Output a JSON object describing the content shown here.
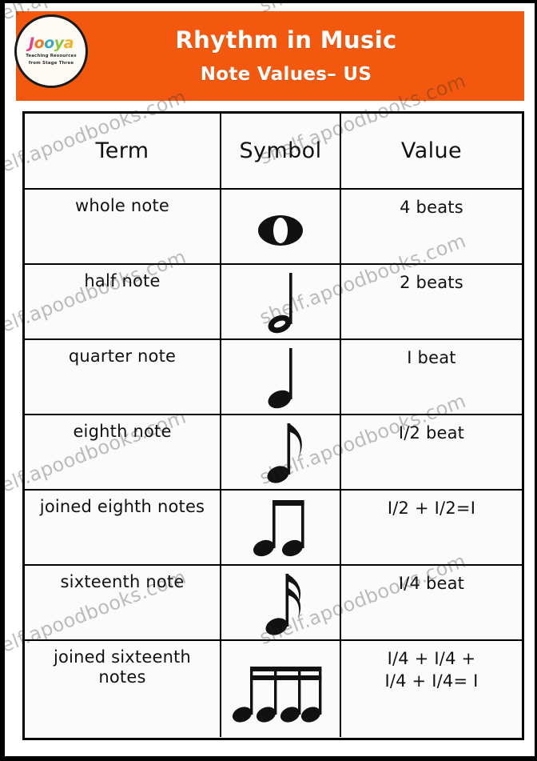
{
  "banner": {
    "title": "Rhythm in Music",
    "subtitle": "Note Values– US",
    "background_color": "#F2590F",
    "text_color": "#FFFFFF"
  },
  "logo": {
    "word": "Jooya",
    "letters": [
      "J",
      "o",
      "o",
      "y",
      "a"
    ],
    "tagline_line1": "Teaching Resources",
    "tagline_line2": "from Stage Three",
    "colors": [
      "#E8418A",
      "#F07C1E",
      "#3AA8C1",
      "#8CC63E",
      "#F0B323"
    ]
  },
  "table": {
    "headers": [
      "Term",
      "Symbol",
      "Value"
    ],
    "rows": [
      {
        "term": "whole note",
        "symbol": "whole-note",
        "value": "4 beats"
      },
      {
        "term": "half note",
        "symbol": "half-note",
        "value": "2 beats"
      },
      {
        "term": "quarter note",
        "symbol": "quarter-note",
        "value": "I beat"
      },
      {
        "term": "eighth note",
        "symbol": "eighth-note",
        "value": "I/2 beat"
      },
      {
        "term": "joined eighth notes",
        "symbol": "joined-eighth-notes",
        "value": "I/2 + I/2=I"
      },
      {
        "term": "sixteenth note",
        "symbol": "sixteenth-note",
        "value": "I/4 beat"
      },
      {
        "term": "joined sixteenth notes",
        "symbol": "joined-sixteenth-notes",
        "value_line1": "I/4 + I/4 +",
        "value_line2": "I/4 + I/4= I"
      }
    ]
  },
  "watermark": {
    "text": "shelf.apoodbooks.com"
  }
}
